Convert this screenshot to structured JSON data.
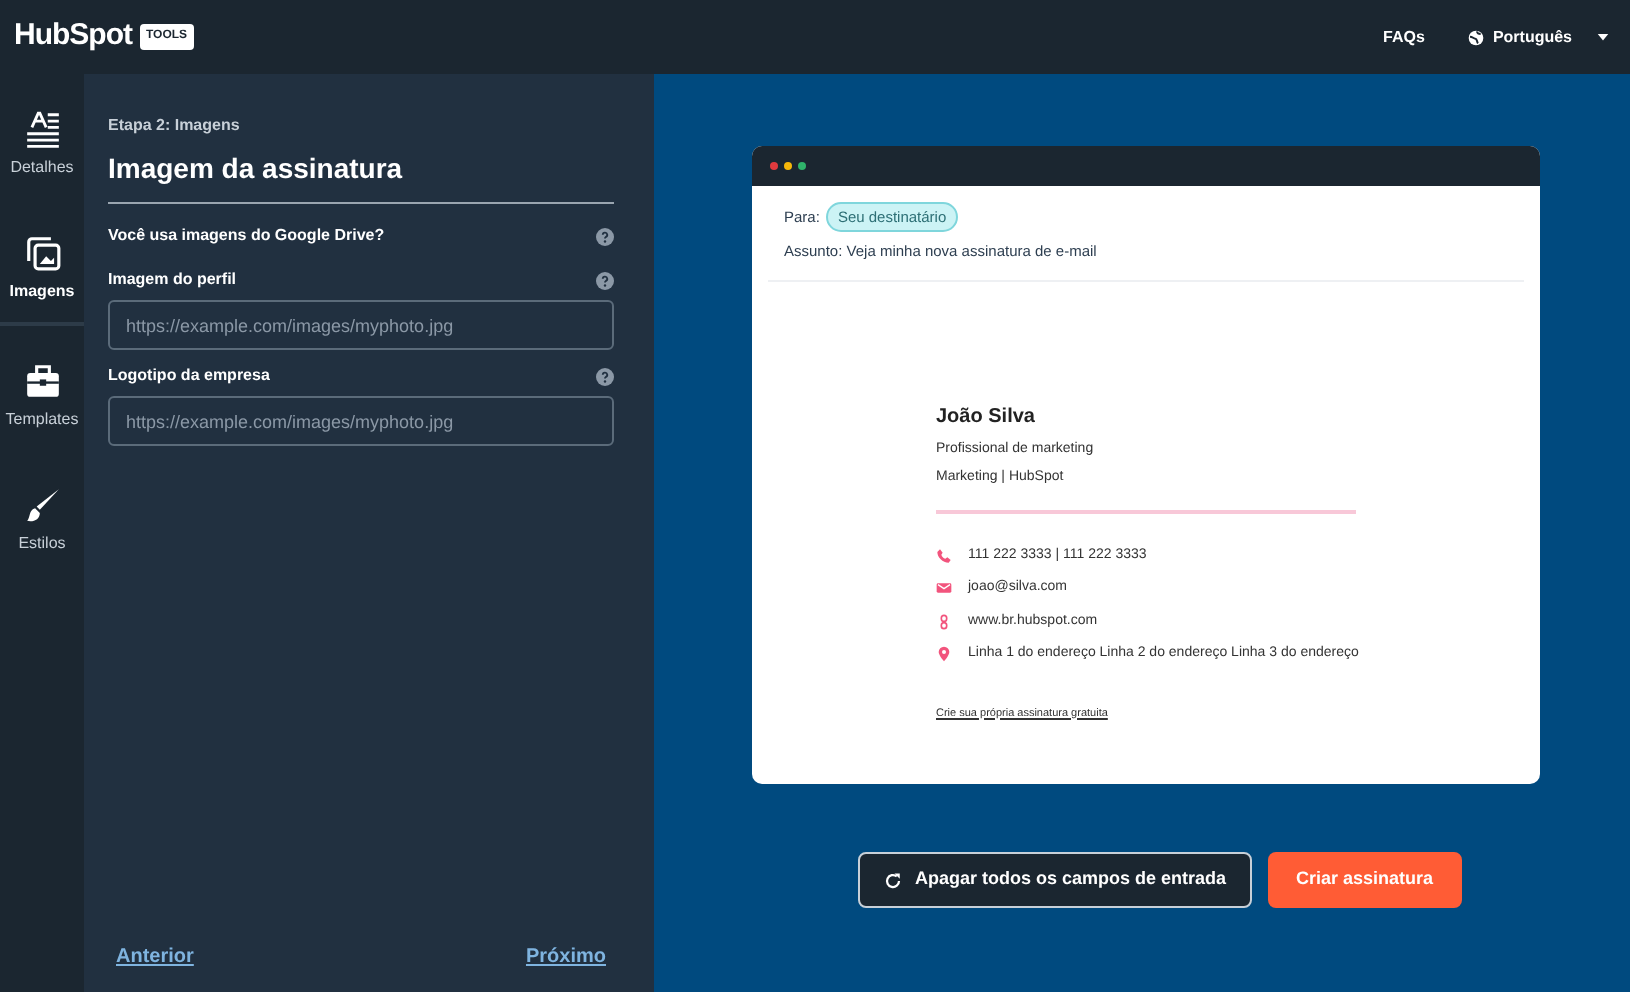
{
  "header": {
    "logo": "HubSpot",
    "logo_badge": "TOOLS",
    "links": [
      {
        "label": "FAQs",
        "kind": "text"
      },
      {
        "label": "Português",
        "kind": "language"
      }
    ]
  },
  "sidebar": {
    "items": [
      {
        "label": "Detalhes",
        "kind": "details",
        "selected": false
      },
      {
        "label": "Imagens",
        "kind": "images",
        "selected": true
      },
      {
        "label": "Templates",
        "kind": "templates",
        "selected": false
      },
      {
        "label": "Estilos",
        "kind": "styles",
        "selected": false
      }
    ]
  },
  "form": {
    "step": "Etapa 2: Imagens",
    "title": "Imagem da assinatura",
    "fields": [
      {
        "label": "Você usa imagens do Google Drive?",
        "kind": "question"
      },
      {
        "label": "Imagem do perfil",
        "kind": "input",
        "placeholder": "https://example.com/images/myphoto.jpg"
      },
      {
        "label": "Logotipo da empresa",
        "kind": "input",
        "placeholder": "https://example.com/images/myphoto.jpg"
      }
    ],
    "prev": "Anterior",
    "next": "Próximo"
  },
  "preview": {
    "to_label": "Para:",
    "to_value": "Seu destinatário",
    "subject": "Assunto: Veja minha nova assinatura de e-mail",
    "signature": {
      "name": "João Silva",
      "role": "Profissional de marketing",
      "company": "Marketing | HubSpot",
      "contacts": [
        {
          "kind": "phone",
          "text": "111 222 3333 | 111 222 3333"
        },
        {
          "kind": "email",
          "text": "joao@silva.com"
        },
        {
          "kind": "web",
          "text": "www.br.hubspot.com"
        },
        {
          "kind": "address",
          "text": "Linha 1 do endereço Linha 2 do endereço Linha 3 do endereço"
        }
      ],
      "footer_link": "Crie sua própria assinatura gratuita"
    }
  },
  "actions": [
    {
      "label": "Apagar todos os campos de entrada",
      "kind": "reset"
    },
    {
      "label": "Criar assinatura",
      "kind": "primary"
    }
  ]
}
